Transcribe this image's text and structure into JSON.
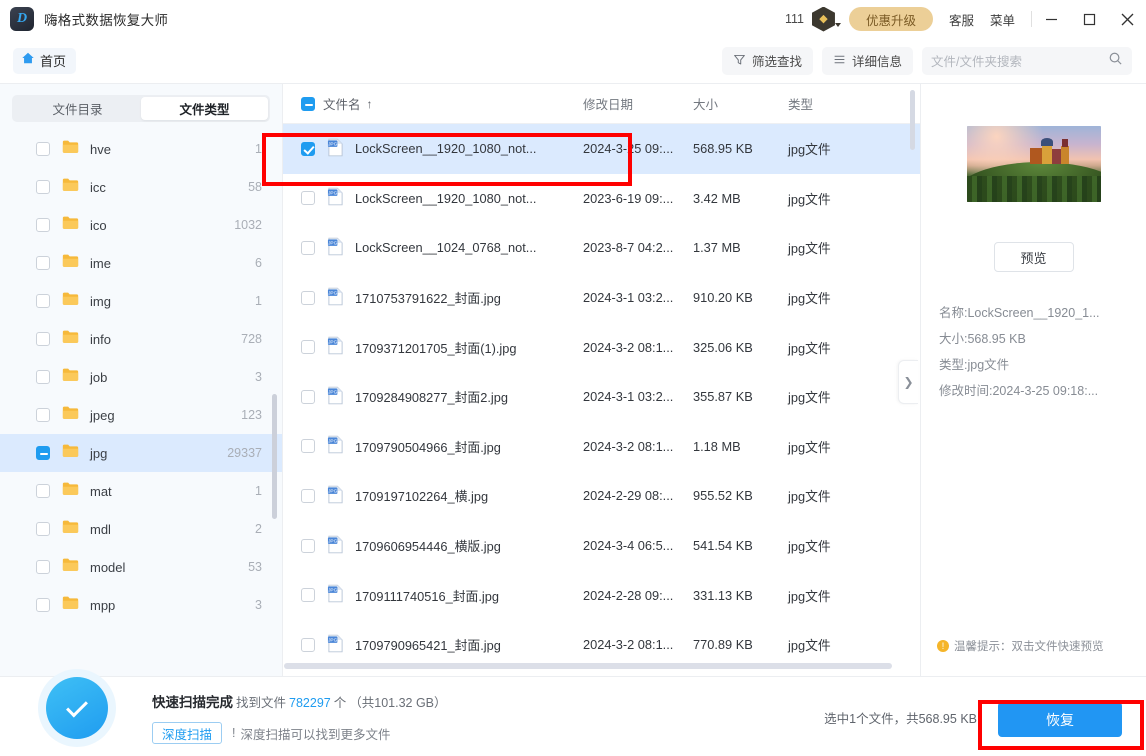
{
  "titlebar": {
    "app_name": "嗨格式数据恢复大师",
    "logo_letter": "D",
    "coin_count": "111",
    "gem_icon": "gem-icon",
    "upgrade_label": "优惠升级",
    "support_label": "客服",
    "menu_label": "菜单",
    "minimize_icon": "minimize-icon",
    "maximize_icon": "maximize-icon",
    "close_icon": "close-icon"
  },
  "subheader": {
    "home_label": "首页",
    "home_icon": "home-icon",
    "filter_label": "筛选查找",
    "filter_icon": "filter-icon",
    "details_label": "详细信息",
    "details_icon": "list-icon",
    "search_placeholder": "文件/文件夹搜索",
    "search_value": "",
    "search_icon": "search-icon"
  },
  "sidebar": {
    "tabs": [
      {
        "label": "文件目录",
        "active": false
      },
      {
        "label": "文件类型",
        "active": true
      }
    ],
    "items": [
      {
        "label": "hve",
        "count": "1",
        "checked": "none",
        "selected": false
      },
      {
        "label": "icc",
        "count": "58",
        "checked": "none",
        "selected": false
      },
      {
        "label": "ico",
        "count": "1032",
        "checked": "none",
        "selected": false
      },
      {
        "label": "ime",
        "count": "6",
        "checked": "none",
        "selected": false
      },
      {
        "label": "img",
        "count": "1",
        "checked": "none",
        "selected": false
      },
      {
        "label": "info",
        "count": "728",
        "checked": "none",
        "selected": false
      },
      {
        "label": "job",
        "count": "3",
        "checked": "none",
        "selected": false
      },
      {
        "label": "jpeg",
        "count": "123",
        "checked": "none",
        "selected": false
      },
      {
        "label": "jpg",
        "count": "29337",
        "checked": "partial",
        "selected": true
      },
      {
        "label": "mat",
        "count": "1",
        "checked": "none",
        "selected": false
      },
      {
        "label": "mdl",
        "count": "2",
        "checked": "none",
        "selected": false
      },
      {
        "label": "model",
        "count": "53",
        "checked": "none",
        "selected": false
      },
      {
        "label": "mpp",
        "count": "3",
        "checked": "none",
        "selected": false
      }
    ]
  },
  "filelist": {
    "columns": {
      "name": "文件名",
      "sort_indicator": "↑",
      "date": "修改日期",
      "size": "大小",
      "type": "类型"
    },
    "rows": [
      {
        "name": "LockScreen__1920_1080_not...",
        "date": "2024-3-25 09:...",
        "size": "568.95 KB",
        "type": "jpg文件",
        "checked": true,
        "selected": true
      },
      {
        "name": "LockScreen__1920_1080_not...",
        "date": "2023-6-19 09:...",
        "size": "3.42 MB",
        "type": "jpg文件",
        "checked": false,
        "selected": false
      },
      {
        "name": "LockScreen__1024_0768_not...",
        "date": "2023-8-7 04:2...",
        "size": "1.37 MB",
        "type": "jpg文件",
        "checked": false,
        "selected": false
      },
      {
        "name": "1710753791622_封面.jpg",
        "date": "2024-3-1 03:2...",
        "size": "910.20 KB",
        "type": "jpg文件",
        "checked": false,
        "selected": false
      },
      {
        "name": "1709371201705_封面(1).jpg",
        "date": "2024-3-2 08:1...",
        "size": "325.06 KB",
        "type": "jpg文件",
        "checked": false,
        "selected": false
      },
      {
        "name": "1709284908277_封面2.jpg",
        "date": "2024-3-1 03:2...",
        "size": "355.87 KB",
        "type": "jpg文件",
        "checked": false,
        "selected": false
      },
      {
        "name": "1709790504966_封面.jpg",
        "date": "2024-3-2 08:1...",
        "size": "1.18 MB",
        "type": "jpg文件",
        "checked": false,
        "selected": false
      },
      {
        "name": "1709197102264_横.jpg",
        "date": "2024-2-29 08:...",
        "size": "955.52 KB",
        "type": "jpg文件",
        "checked": false,
        "selected": false
      },
      {
        "name": "1709606954446_横版.jpg",
        "date": "2024-3-4 06:5...",
        "size": "541.54 KB",
        "type": "jpg文件",
        "checked": false,
        "selected": false
      },
      {
        "name": "1709111740516_封面.jpg",
        "date": "2024-2-28 09:...",
        "size": "331.13 KB",
        "type": "jpg文件",
        "checked": false,
        "selected": false
      },
      {
        "name": "1709790965421_封面.jpg",
        "date": "2024-3-2 08:1...",
        "size": "770.89 KB",
        "type": "jpg文件",
        "checked": false,
        "selected": false
      }
    ],
    "collapse_icon": "chevron-right-icon"
  },
  "preview": {
    "thumbnail_alt": "castle-on-hill-sunset",
    "preview_button": "预览",
    "meta": [
      "名称:LockScreen__1920_1...",
      "大小:568.95 KB",
      "类型:jpg文件",
      "修改时间:2024-3-25 09:18:..."
    ],
    "tip": "温馨提示：双击文件快速预览"
  },
  "bottom": {
    "status_title": "快速扫描完成",
    "found_prefix": "找到文件",
    "found_count": "782297",
    "found_suffix": "个",
    "total_size": "（共101.32 GB）",
    "deep_scan_label": "深度扫描",
    "deep_scan_tip": "深度扫描可以找到更多文件",
    "selection_info": "选中1个文件，共568.95 KB",
    "recover_label": "恢复"
  },
  "colors": {
    "accent": "#1f9cf0",
    "recover_button": "#2196f3",
    "selection_row": "#dbeafe",
    "upgrade_gold": "#eccf97",
    "annotation_red": "#ff0000"
  }
}
